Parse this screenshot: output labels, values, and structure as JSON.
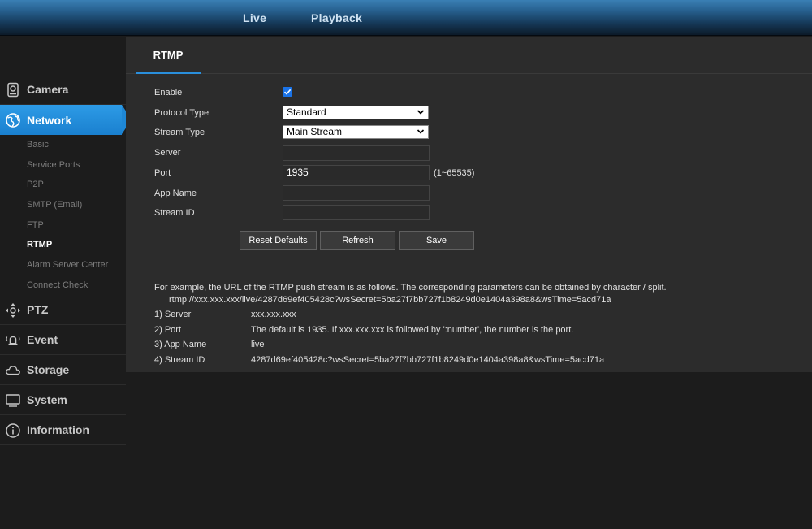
{
  "topbar": {
    "live": "Live",
    "playback": "Playback"
  },
  "sidebar": {
    "camera": "Camera",
    "network": "Network",
    "subitems": [
      "Basic",
      "Service Ports",
      "P2P",
      "SMTP (Email)",
      "FTP",
      "RTMP",
      "Alarm Server Center",
      "Connect Check"
    ],
    "active_subitem": "RTMP",
    "ptz": "PTZ",
    "event": "Event",
    "storage": "Storage",
    "system": "System",
    "information": "Information"
  },
  "panel": {
    "tab": "RTMP",
    "form": {
      "enable_label": "Enable",
      "enable_checked": true,
      "protocol_type_label": "Protocol Type",
      "protocol_type_value": "Standard",
      "stream_type_label": "Stream Type",
      "stream_type_value": "Main Stream",
      "server_label": "Server",
      "server_value": "",
      "port_label": "Port",
      "port_value": "1935",
      "port_range": "(1~65535)",
      "app_name_label": "App Name",
      "app_name_value": "",
      "stream_id_label": "Stream ID",
      "stream_id_value": ""
    },
    "buttons": {
      "reset": "Reset Defaults",
      "refresh": "Refresh",
      "save": "Save"
    },
    "notes": {
      "intro": "For example, the URL of the RTMP push stream is as follows. The corresponding parameters can be obtained by character / split.",
      "example_url": "rtmp://xxx.xxx.xxx/live/4287d69ef405428c?wsSecret=5ba27f7bb727f1b8249d0e1404a398a8&wsTime=5acd71a",
      "rows": [
        {
          "key": "1) Server",
          "value": "xxx.xxx.xxx"
        },
        {
          "key": "2) Port",
          "value": "The default is 1935. If xxx.xxx.xxx is followed by ':number', the number is the port."
        },
        {
          "key": "3) App Name",
          "value": "live"
        },
        {
          "key": "4) Stream ID",
          "value": "4287d69ef405428c?wsSecret=5ba27f7bb727f1b8249d0e1404a398a8&wsTime=5acd71a"
        }
      ]
    }
  },
  "colors": {
    "accent": "#2a8fdc",
    "active_nav": "#1e87d6",
    "panel": "#2c2c2c",
    "background": "#1c1c1c"
  }
}
